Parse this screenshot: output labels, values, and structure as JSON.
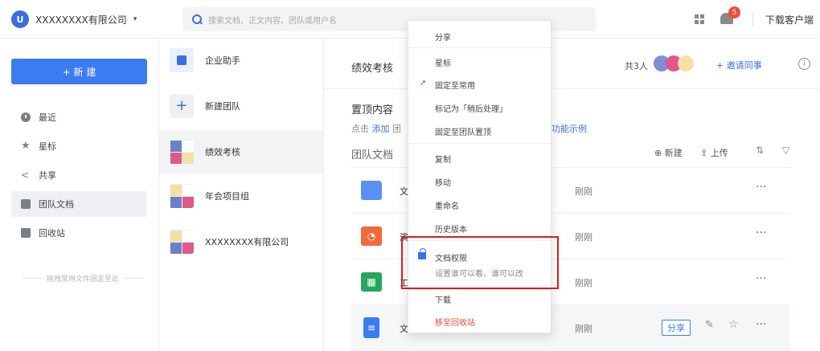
{
  "header": {
    "company_logo_text": "U",
    "company_name": "XXXXXXXX有限公司",
    "caret": "▾",
    "search_placeholder": "搜索文档、正文内容、团队或用户名",
    "notification_count": "5",
    "download_client": "下载客户端"
  },
  "leftnav": {
    "new_button": "+ 新 建",
    "items": [
      {
        "label": "最近",
        "icon": "clock-icon"
      },
      {
        "label": "星标",
        "icon": "star-icon"
      },
      {
        "label": "共享",
        "icon": "share-icon"
      },
      {
        "label": "团队文档",
        "icon": "team-icon"
      },
      {
        "label": "回收站",
        "icon": "trash-icon"
      }
    ],
    "pin_hint": "拖拽常用文件固定至此"
  },
  "teams": {
    "items": [
      {
        "label": "企业助手"
      },
      {
        "label": "新建团队"
      },
      {
        "label": "绩效考核"
      },
      {
        "label": "年会项目组"
      },
      {
        "label": "XXXXXXXX有限公司"
      }
    ]
  },
  "main": {
    "title": "绩效考核",
    "member_count": "共3人",
    "invite": "+ 邀请同事",
    "info_icon": "i",
    "pinned_title": "置顶内容",
    "pinned_tip_prefix": "点击",
    "pinned_tip_link": "添加",
    "pinned_tip_suffix": "团",
    "function_example": "功能示例",
    "team_docs_title": "团队文档",
    "tool_new": "新建",
    "tool_upload": "上传",
    "files": [
      {
        "name": "文",
        "time": "刚刚",
        "type": "folder-icon"
      },
      {
        "name": "演",
        "time": "刚刚",
        "type": "slides-icon"
      },
      {
        "name": "工",
        "time": "刚刚",
        "type": "sheet-icon"
      },
      {
        "name": "文",
        "time": "刚刚",
        "type": "doc-icon"
      }
    ],
    "row_share": "分享",
    "more": "···"
  },
  "context_menu": {
    "items": [
      {
        "label": "分享"
      },
      {
        "label": "星标"
      },
      {
        "label": "固定至常用"
      },
      {
        "label": "标记为「稍后处理」"
      },
      {
        "label": "固定至团队置顶"
      },
      {
        "label": "复制"
      },
      {
        "label": "移动"
      },
      {
        "label": "重命名"
      },
      {
        "label": "历史版本"
      },
      {
        "label": "文档权限",
        "sub": "设置谁可以看、谁可以改"
      },
      {
        "label": "下载"
      },
      {
        "label": "移至回收站"
      }
    ]
  },
  "colors": {
    "accent": "#3b7cf0",
    "danger": "#e84a3b",
    "highlight_box": "#d81e1e"
  }
}
